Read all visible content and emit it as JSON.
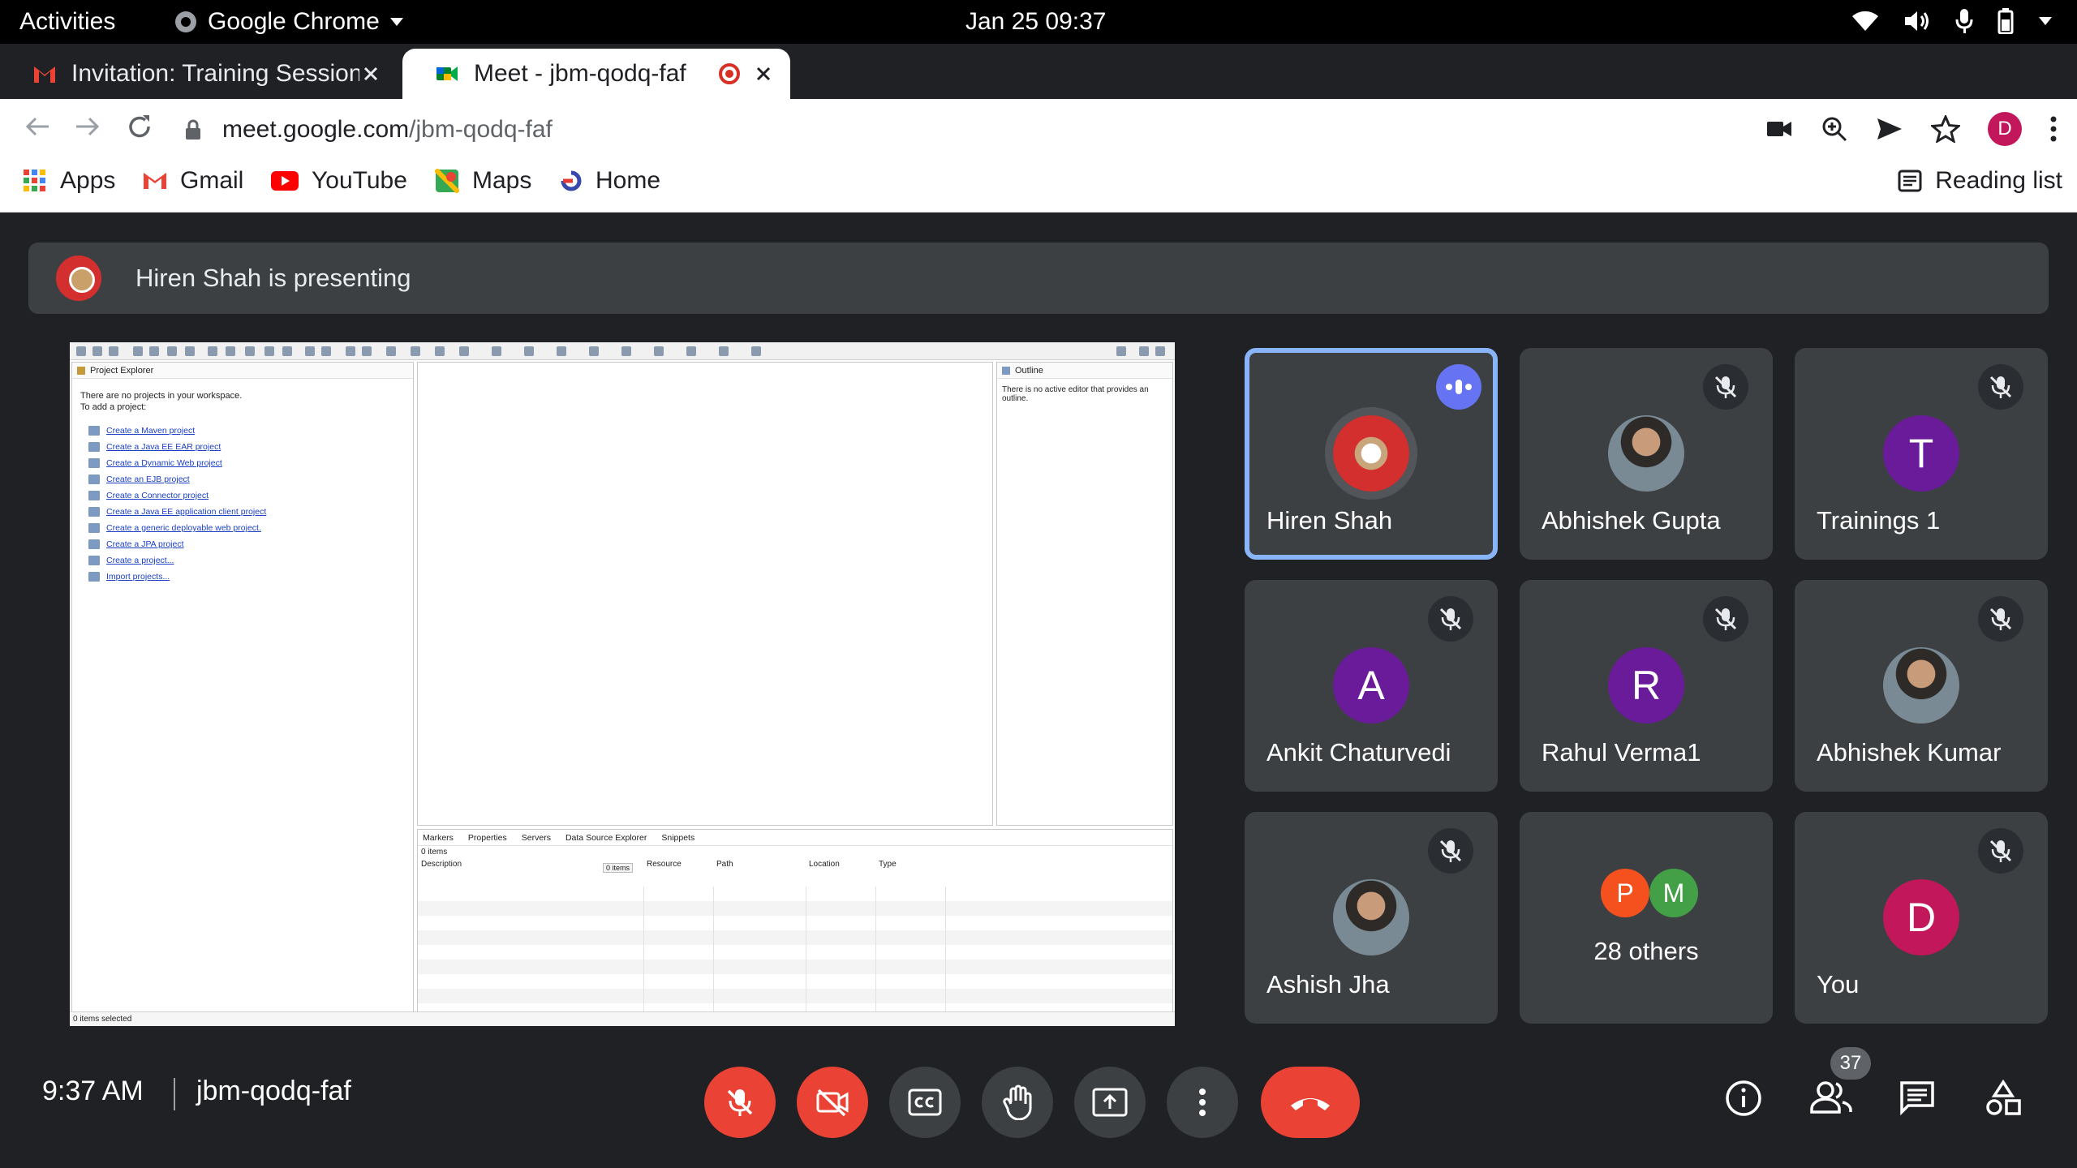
{
  "system": {
    "activities": "Activities",
    "app_menu": "Google Chrome",
    "datetime": "Jan 25  09:37"
  },
  "tabs": [
    {
      "title": "Invitation: Training Session",
      "favicon": "gmail-icon"
    },
    {
      "title": "Meet - jbm-qodq-faf",
      "favicon": "meet-icon",
      "active": true
    }
  ],
  "address_bar": {
    "host": "meet.google.com",
    "path": "/jbm-qodq-faf"
  },
  "profile": {
    "initial": "D",
    "color": "#c2185b"
  },
  "bookmarks": [
    {
      "label": "Apps",
      "icon": "apps-grid-icon"
    },
    {
      "label": "Gmail",
      "icon": "gmail-icon"
    },
    {
      "label": "YouTube",
      "icon": "youtube-icon"
    },
    {
      "label": "Maps",
      "icon": "maps-icon"
    },
    {
      "label": "Home",
      "icon": "home-icon"
    }
  ],
  "reading_list": "Reading list",
  "meet": {
    "presenting_text": "Hiren Shah is presenting",
    "shared_screen": {
      "project_explorer_title": "Project Explorer",
      "intro_line1": "There are no projects in your workspace.",
      "intro_line2": "To add a project:",
      "links": [
        "Create a Maven project",
        "Create a Java EE EAR project",
        "Create a Dynamic Web project",
        "Create an EJB project",
        "Create a Connector project",
        "Create a Java EE application client project",
        "Create a generic deployable web project.",
        "Create a JPA project",
        "Create a project...",
        "Import projects..."
      ],
      "outline_title": "Outline",
      "outline_message": "There is no active editor that provides an outline.",
      "bottom_tabs": [
        "Markers",
        "Properties",
        "Servers",
        "Data Source Explorer",
        "Snippets"
      ],
      "items_count": "0 items",
      "tooltip": "0 items",
      "columns": [
        "Description",
        "Resource",
        "Path",
        "Location",
        "Type"
      ],
      "status": "0 items selected"
    },
    "participants": [
      {
        "name": "Hiren Shah",
        "speaking": true
      },
      {
        "name": "Abhishek Gupta"
      },
      {
        "name": "Trainings 1",
        "initial": "T",
        "color": "#6a1b9a"
      },
      {
        "name": "Ankit Chaturvedi",
        "initial": "A",
        "color": "#6a1b9a"
      },
      {
        "name": "Rahul Verma1",
        "initial": "R",
        "color": "#6a1b9a"
      },
      {
        "name": "Abhishek Kumar"
      },
      {
        "name": "Ashish Jha"
      },
      {
        "others_label": "28 others",
        "initials": [
          "P",
          "M"
        ],
        "colors": [
          "#f4511e",
          "#43a047"
        ]
      },
      {
        "name": "You",
        "initial": "D",
        "color": "#c2185b"
      }
    ],
    "time": "9:37 AM",
    "meeting_code": "jbm-qodq-faf",
    "people_count": "37",
    "colors": {
      "accent": "#8ab4f8",
      "danger": "#ea4335",
      "surface": "#3c4043",
      "background": "#202124"
    }
  }
}
